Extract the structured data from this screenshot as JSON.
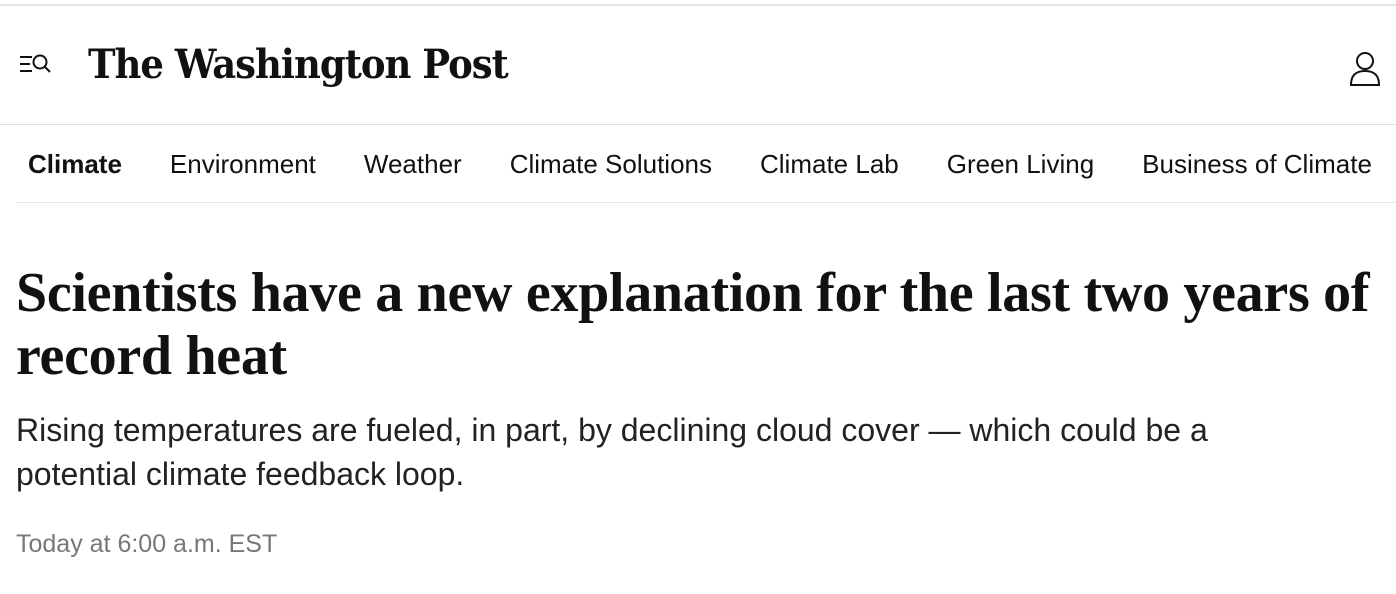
{
  "header": {
    "logo_text": "The Washington Post",
    "menu_icon": "menu-search-icon",
    "account_icon": "user-icon"
  },
  "nav": {
    "items": [
      {
        "label": "Climate",
        "active": true
      },
      {
        "label": "Environment",
        "active": false
      },
      {
        "label": "Weather",
        "active": false
      },
      {
        "label": "Climate Solutions",
        "active": false
      },
      {
        "label": "Climate Lab",
        "active": false
      },
      {
        "label": "Green Living",
        "active": false
      },
      {
        "label": "Business of Climate",
        "active": false
      }
    ]
  },
  "article": {
    "headline": "Scientists have a new explanation for the last two years of record heat",
    "dek": "Rising temperatures are fueled, in part, by declining cloud cover — which could be a potential climate feedback loop.",
    "timestamp": "Today at 6:00 a.m. EST"
  }
}
